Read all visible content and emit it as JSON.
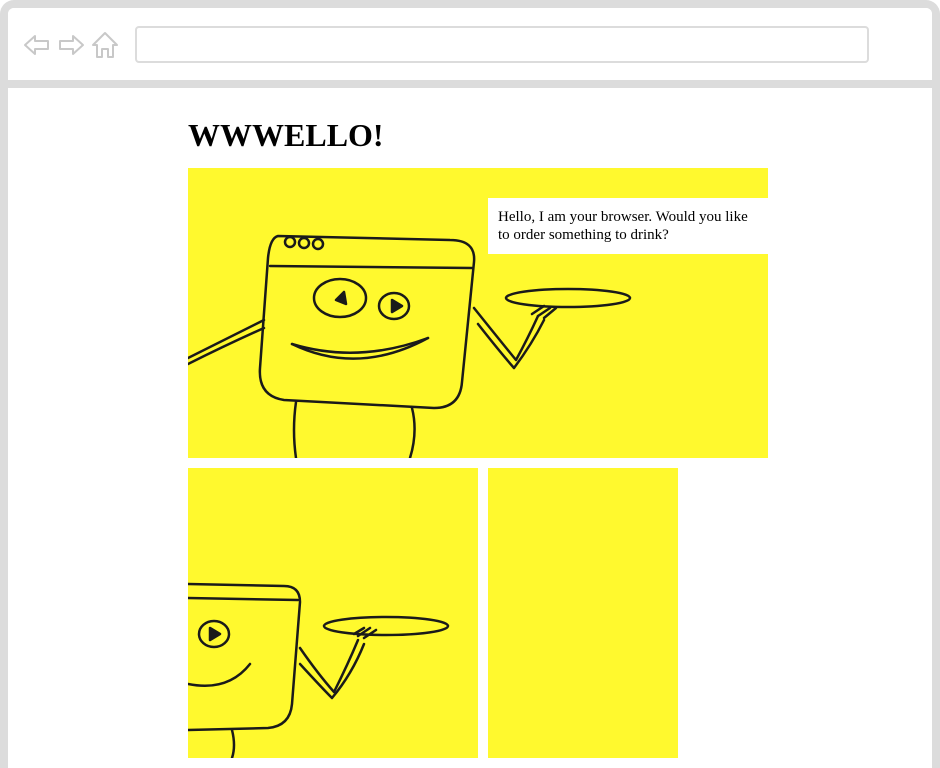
{
  "browser": {
    "url_value": "",
    "icons": {
      "back": "back-arrow-icon",
      "forward": "forward-arrow-icon",
      "home": "home-icon"
    },
    "chrome_color": "#dcdcdc"
  },
  "page": {
    "title": "WWWELLO!",
    "panel_color": "#fff92e",
    "speech_bubble": "Hello, I am your browser. Would you like to order something to drink?"
  }
}
